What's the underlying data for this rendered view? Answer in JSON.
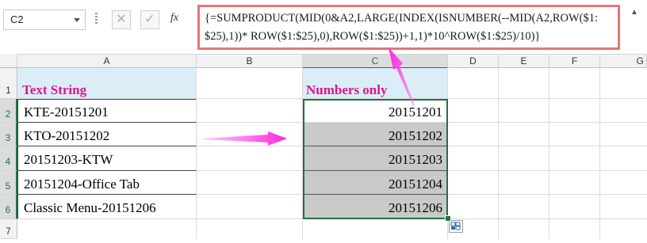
{
  "name_box": {
    "value": "C2"
  },
  "formula_bar": {
    "cancel_symbol": "✕",
    "enter_symbol": "✓",
    "fx_label": "fx",
    "formula": "{=SUMPRODUCT(MID(0&A2,LARGE(INDEX(ISNUMBER(--MID(A2,ROW($1:\n$25),1))* ROW($1:$25),0),ROW($1:$25))+1,1)*10^ROW($1:$25)/10)}",
    "highlight_color": "#e87575"
  },
  "columns": [
    "A",
    "B",
    "C",
    "D",
    "E",
    "F",
    "G"
  ],
  "rows": [
    "1",
    "2",
    "3",
    "4",
    "5",
    "6",
    "7"
  ],
  "column_a": {
    "header": "Text String",
    "values": [
      "KTE-20151201",
      "KTO-20151202",
      "20151203-KTW",
      "20151204-Office Tab",
      "Classic Menu-20151206"
    ]
  },
  "column_c": {
    "header": "Numbers only",
    "values": [
      "20151201",
      "20151202",
      "20151203",
      "20151204",
      "20151206"
    ]
  },
  "colors": {
    "header_text": "#e0148a",
    "header_fill": "#dbeef8",
    "arrow": "#ff33dd",
    "selection": "#217346",
    "gray_fill": "#c9c9c9"
  }
}
